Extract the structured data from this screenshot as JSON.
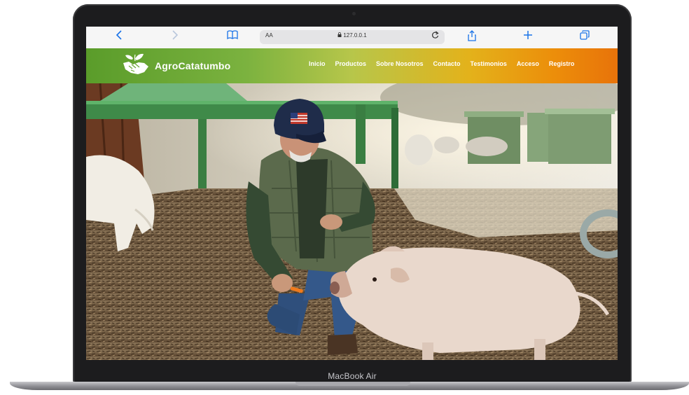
{
  "device": {
    "model_label": "MacBook Air"
  },
  "browser": {
    "reader_label": "AA",
    "url": "127.0.0.1",
    "back_icon": "chevron-left-icon",
    "forward_icon": "chevron-right-icon",
    "bookmarks_icon": "book-icon",
    "share_icon": "share-icon",
    "new_tab_icon": "plus-icon",
    "tabs_icon": "tabs-icon",
    "reload_icon": "reload-icon"
  },
  "site": {
    "brand": "AgroCatatumbo",
    "logo_icon": "handshake-leaf-icon",
    "nav": [
      {
        "label": "Inicio"
      },
      {
        "label": "Productos"
      },
      {
        "label": "Sobre Nosotros"
      },
      {
        "label": "Contacto"
      },
      {
        "label": "Testimonios"
      },
      {
        "label": "Acceso"
      },
      {
        "label": "Registro"
      }
    ],
    "header_colors": [
      "#5a9c2a",
      "#b7c64a",
      "#e3b21b",
      "#e8730a"
    ],
    "hero_image": "farmer-feeding-pig-photo"
  }
}
